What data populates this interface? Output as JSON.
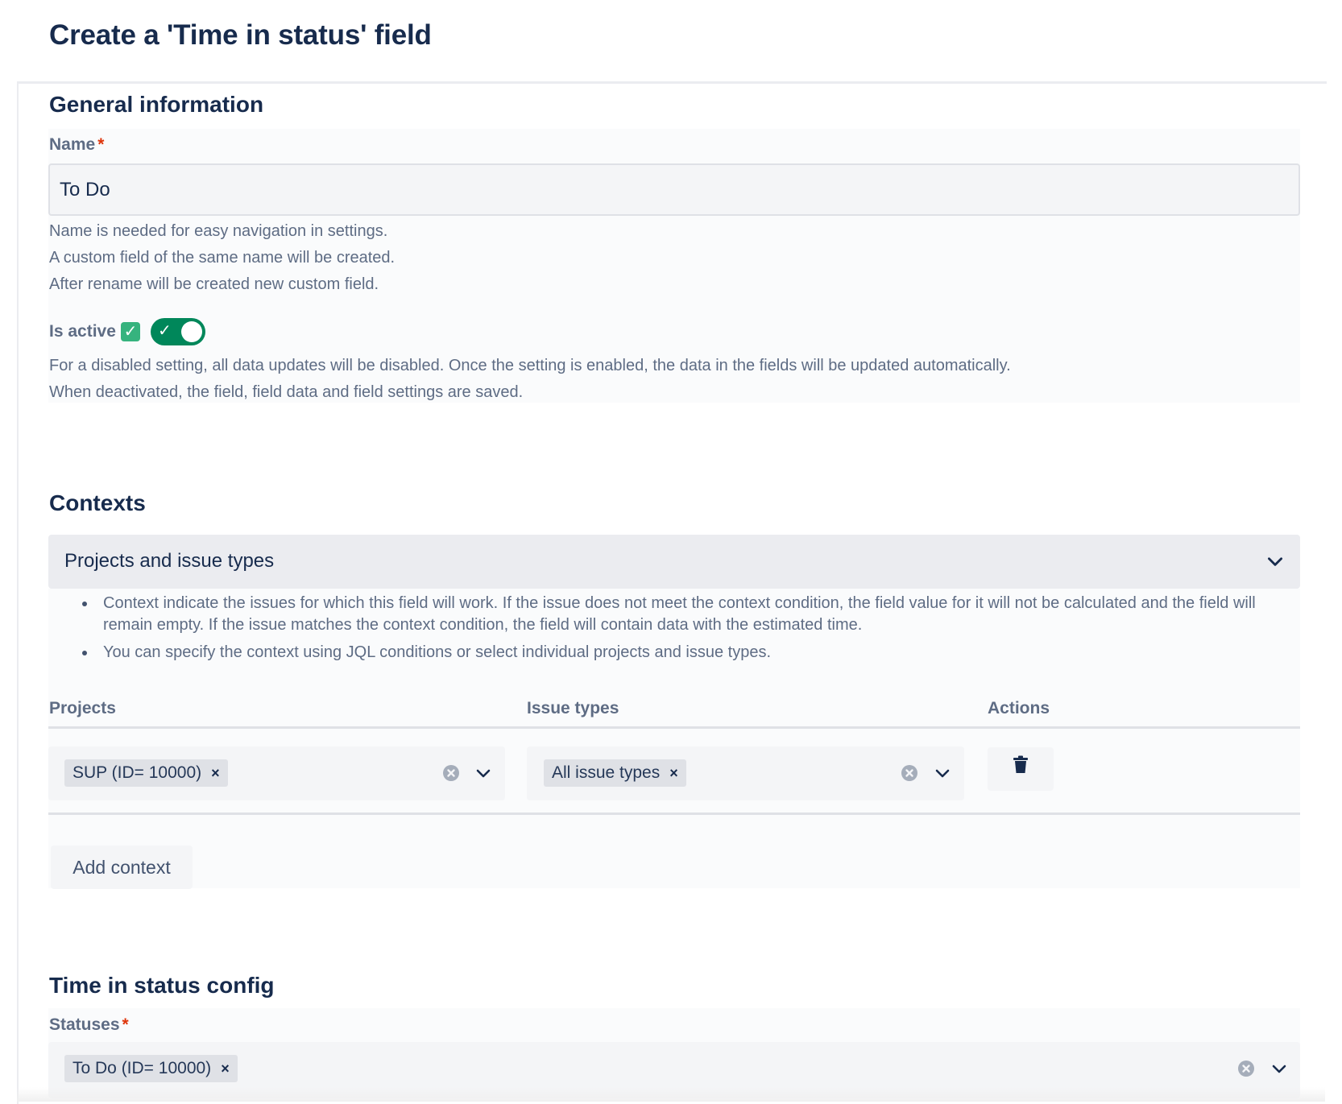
{
  "page": {
    "title": "Create a 'Time in status' field"
  },
  "general": {
    "section_title": "General information",
    "name_label": "Name",
    "required_mark": "*",
    "name_value": "To Do",
    "name_help": [
      "Name is needed for easy navigation in settings.",
      "A custom field of the same name will be created.",
      "After rename will be created new custom field."
    ],
    "active_label": "Is active",
    "active_emoji": "✓",
    "active_on": true,
    "active_help": [
      "For a disabled setting, all data updates will be disabled. Once the setting is enabled, the data in the fields will be updated automatically.",
      "When deactivated, the field, field data and field settings are saved."
    ]
  },
  "contexts": {
    "section_title": "Contexts",
    "accordion_label": "Projects and issue types",
    "bullets": [
      "Context indicate the issues for which this field will work. If the issue does not meet the context condition, the field value for it will not be calculated and the field will remain empty. If the issue matches the context condition, the field will contain data with the estimated time.",
      "You can specify the context using JQL conditions or select individual projects and issue types."
    ],
    "columns": {
      "projects": "Projects",
      "issue_types": "Issue types",
      "actions": "Actions"
    },
    "rows": [
      {
        "project_chip": "SUP (ID= 10000)",
        "issue_type_chip": "All issue types"
      }
    ],
    "add_button": "Add context"
  },
  "config": {
    "section_title": "Time in status config",
    "statuses_label": "Statuses",
    "status_chip": "To Do (ID= 10000)"
  },
  "icons": {
    "remove_chip": "×",
    "clear": "clear-icon",
    "chevron": "chevron-down-icon",
    "trash": "trash-icon"
  },
  "colors": {
    "toggle_on": "#00875a",
    "required": "#de350b",
    "heading": "#172b4d",
    "muted": "#5e6c84"
  }
}
